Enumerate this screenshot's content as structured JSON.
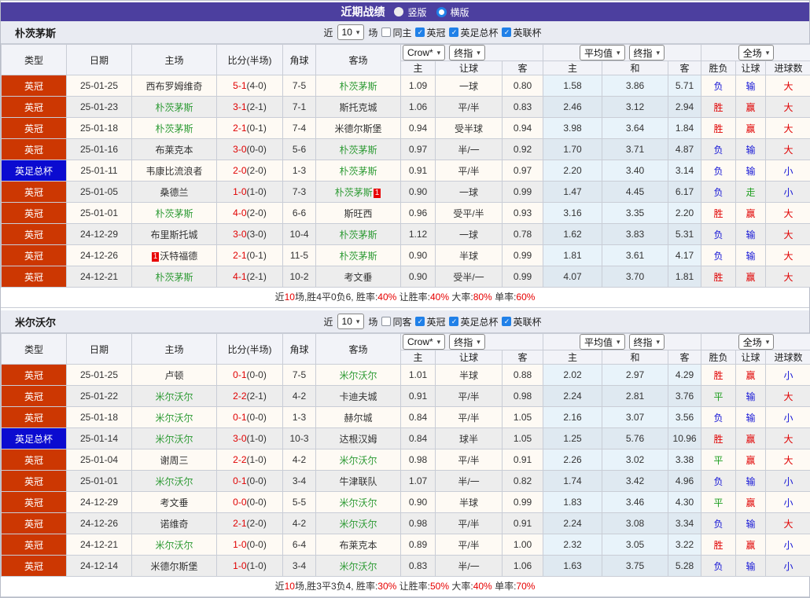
{
  "icons": {
    "check": "✓",
    "chevron_down": "▾"
  },
  "topbar": {
    "title": "近期战绩",
    "vertical": "竖版",
    "horizontal": "横版"
  },
  "labels": {
    "near": "近",
    "games": "场"
  },
  "controls": {
    "count": "10",
    "bookmaker": "Crow*",
    "stage": "终指",
    "average": "平均值",
    "stage2": "终指",
    "scope": "全场"
  },
  "filters": {
    "leagues": [
      "英冠",
      "英足总杯",
      "英联杯"
    ]
  },
  "columns": {
    "type": "类型",
    "date": "日期",
    "home": "主场",
    "score": "比分(半场)",
    "corner": "角球",
    "away": "客场"
  },
  "sub_columns": {
    "asian_home": "主",
    "asian_handicap": "让球",
    "asian_away": "客",
    "euro_home": "主",
    "euro_draw": "和",
    "euro_away": "客",
    "result_wdl": "胜负",
    "result_handicap": "让球",
    "result_goals": "进球数"
  },
  "colors": {
    "purple": "#4c3f9f",
    "league_orange": "#cc3702",
    "cup_blue": "#0b0bd0",
    "self_green": "#2e9b35",
    "win_red": "#e00000",
    "lose_blue": "#1616d6",
    "draw_green": "#1f9e1f",
    "checkbox_blue": "#2080e8"
  },
  "sections": [
    {
      "team": "朴茨茅斯",
      "same_label": "同主",
      "rows": [
        {
          "lg": "英冠",
          "cup": false,
          "date": "25-01-25",
          "home": "西布罗姆维奇",
          "hg": false,
          "hb": "",
          "score": "5-1",
          "half": "(4-0)",
          "corner": "7-5",
          "away": "朴茨茅斯",
          "ag": true,
          "ab": "",
          "asian": [
            "1.09",
            "一球",
            "0.80"
          ],
          "euro": [
            "1.58",
            "3.86",
            "5.71"
          ],
          "res": [
            "负",
            "输",
            "大"
          ],
          "rc": [
            "b",
            "b",
            "r"
          ]
        },
        {
          "lg": "英冠",
          "cup": false,
          "date": "25-01-23",
          "home": "朴茨茅斯",
          "hg": true,
          "hb": "",
          "score": "3-1",
          "half": "(2-1)",
          "corner": "7-1",
          "away": "斯托克城",
          "ag": false,
          "ab": "",
          "asian": [
            "1.06",
            "平/半",
            "0.83"
          ],
          "euro": [
            "2.46",
            "3.12",
            "2.94"
          ],
          "res": [
            "胜",
            "赢",
            "大"
          ],
          "rc": [
            "r",
            "r",
            "r"
          ]
        },
        {
          "lg": "英冠",
          "cup": false,
          "date": "25-01-18",
          "home": "朴茨茅斯",
          "hg": true,
          "hb": "",
          "score": "2-1",
          "half": "(0-1)",
          "corner": "7-4",
          "away": "米德尔斯堡",
          "ag": false,
          "ab": "",
          "asian": [
            "0.94",
            "受半球",
            "0.94"
          ],
          "euro": [
            "3.98",
            "3.64",
            "1.84"
          ],
          "res": [
            "胜",
            "赢",
            "大"
          ],
          "rc": [
            "r",
            "r",
            "r"
          ]
        },
        {
          "lg": "英冠",
          "cup": false,
          "date": "25-01-16",
          "home": "布莱克本",
          "hg": false,
          "hb": "",
          "score": "3-0",
          "half": "(0-0)",
          "corner": "5-6",
          "away": "朴茨茅斯",
          "ag": true,
          "ab": "",
          "asian": [
            "0.97",
            "半/一",
            "0.92"
          ],
          "euro": [
            "1.70",
            "3.71",
            "4.87"
          ],
          "res": [
            "负",
            "输",
            "大"
          ],
          "rc": [
            "b",
            "b",
            "r"
          ]
        },
        {
          "lg": "英足总杯",
          "cup": true,
          "date": "25-01-11",
          "home": "韦康比流浪者",
          "hg": false,
          "hb": "",
          "score": "2-0",
          "half": "(2-0)",
          "corner": "1-3",
          "away": "朴茨茅斯",
          "ag": true,
          "ab": "",
          "asian": [
            "0.91",
            "平/半",
            "0.97"
          ],
          "euro": [
            "2.20",
            "3.40",
            "3.14"
          ],
          "res": [
            "负",
            "输",
            "小"
          ],
          "rc": [
            "b",
            "b",
            "b"
          ]
        },
        {
          "lg": "英冠",
          "cup": false,
          "date": "25-01-05",
          "home": "桑德兰",
          "hg": false,
          "hb": "",
          "score": "1-0",
          "half": "(1-0)",
          "corner": "7-3",
          "away": "朴茨茅斯",
          "ag": true,
          "ab": "1",
          "asian": [
            "0.90",
            "一球",
            "0.99"
          ],
          "euro": [
            "1.47",
            "4.45",
            "6.17"
          ],
          "res": [
            "负",
            "走",
            "小"
          ],
          "rc": [
            "b",
            "g",
            "b"
          ]
        },
        {
          "lg": "英冠",
          "cup": false,
          "date": "25-01-01",
          "home": "朴茨茅斯",
          "hg": true,
          "hb": "",
          "score": "4-0",
          "half": "(2-0)",
          "corner": "6-6",
          "away": "斯旺西",
          "ag": false,
          "ab": "",
          "asian": [
            "0.96",
            "受平/半",
            "0.93"
          ],
          "euro": [
            "3.16",
            "3.35",
            "2.20"
          ],
          "res": [
            "胜",
            "赢",
            "大"
          ],
          "rc": [
            "r",
            "r",
            "r"
          ]
        },
        {
          "lg": "英冠",
          "cup": false,
          "date": "24-12-29",
          "home": "布里斯托城",
          "hg": false,
          "hb": "",
          "score": "3-0",
          "half": "(3-0)",
          "corner": "10-4",
          "away": "朴茨茅斯",
          "ag": true,
          "ab": "",
          "asian": [
            "1.12",
            "一球",
            "0.78"
          ],
          "euro": [
            "1.62",
            "3.83",
            "5.31"
          ],
          "res": [
            "负",
            "输",
            "大"
          ],
          "rc": [
            "b",
            "b",
            "r"
          ]
        },
        {
          "lg": "英冠",
          "cup": false,
          "date": "24-12-26",
          "home": "沃特福德",
          "hg": false,
          "hb": "1",
          "score": "2-1",
          "half": "(0-1)",
          "corner": "11-5",
          "away": "朴茨茅斯",
          "ag": true,
          "ab": "",
          "asian": [
            "0.90",
            "半球",
            "0.99"
          ],
          "euro": [
            "1.81",
            "3.61",
            "4.17"
          ],
          "res": [
            "负",
            "输",
            "大"
          ],
          "rc": [
            "b",
            "b",
            "r"
          ]
        },
        {
          "lg": "英冠",
          "cup": false,
          "date": "24-12-21",
          "home": "朴茨茅斯",
          "hg": true,
          "hb": "",
          "score": "4-1",
          "half": "(2-1)",
          "corner": "10-2",
          "away": "考文垂",
          "ag": false,
          "ab": "",
          "asian": [
            "0.90",
            "受半/一",
            "0.99"
          ],
          "euro": [
            "4.07",
            "3.70",
            "1.81"
          ],
          "res": [
            "胜",
            "赢",
            "大"
          ],
          "rc": [
            "r",
            "r",
            "r"
          ]
        }
      ],
      "summary": {
        "t1": "近",
        "games": "10",
        "record": "场,胜4平0负6, 胜率:",
        "win": "40%",
        "t2": " 让胜率:",
        "hcp": "40%",
        "t3": " 大率:",
        "big": "80%",
        "t4": " 单率:",
        "single": "60%"
      }
    },
    {
      "team": "米尔沃尔",
      "same_label": "同客",
      "rows": [
        {
          "lg": "英冠",
          "cup": false,
          "date": "25-01-25",
          "home": "卢顿",
          "hg": false,
          "hb": "",
          "score": "0-1",
          "half": "(0-0)",
          "corner": "7-5",
          "away": "米尔沃尔",
          "ag": true,
          "ab": "",
          "asian": [
            "1.01",
            "半球",
            "0.88"
          ],
          "euro": [
            "2.02",
            "2.97",
            "4.29"
          ],
          "res": [
            "胜",
            "赢",
            "小"
          ],
          "rc": [
            "r",
            "r",
            "b"
          ]
        },
        {
          "lg": "英冠",
          "cup": false,
          "date": "25-01-22",
          "home": "米尔沃尔",
          "hg": true,
          "hb": "",
          "score": "2-2",
          "half": "(2-1)",
          "corner": "4-2",
          "away": "卡迪夫城",
          "ag": false,
          "ab": "",
          "asian": [
            "0.91",
            "平/半",
            "0.98"
          ],
          "euro": [
            "2.24",
            "2.81",
            "3.76"
          ],
          "res": [
            "平",
            "输",
            "大"
          ],
          "rc": [
            "g",
            "b",
            "r"
          ]
        },
        {
          "lg": "英冠",
          "cup": false,
          "date": "25-01-18",
          "home": "米尔沃尔",
          "hg": true,
          "hb": "",
          "score": "0-1",
          "half": "(0-0)",
          "corner": "1-3",
          "away": "赫尔城",
          "ag": false,
          "ab": "",
          "asian": [
            "0.84",
            "平/半",
            "1.05"
          ],
          "euro": [
            "2.16",
            "3.07",
            "3.56"
          ],
          "res": [
            "负",
            "输",
            "小"
          ],
          "rc": [
            "b",
            "b",
            "b"
          ]
        },
        {
          "lg": "英足总杯",
          "cup": true,
          "date": "25-01-14",
          "home": "米尔沃尔",
          "hg": true,
          "hb": "",
          "score": "3-0",
          "half": "(1-0)",
          "corner": "10-3",
          "away": "达根汉姆",
          "ag": false,
          "ab": "",
          "asian": [
            "0.84",
            "球半",
            "1.05"
          ],
          "euro": [
            "1.25",
            "5.76",
            "10.96"
          ],
          "res": [
            "胜",
            "赢",
            "大"
          ],
          "rc": [
            "r",
            "r",
            "r"
          ]
        },
        {
          "lg": "英冠",
          "cup": false,
          "date": "25-01-04",
          "home": "谢周三",
          "hg": false,
          "hb": "",
          "score": "2-2",
          "half": "(1-0)",
          "corner": "4-2",
          "away": "米尔沃尔",
          "ag": true,
          "ab": "",
          "asian": [
            "0.98",
            "平/半",
            "0.91"
          ],
          "euro": [
            "2.26",
            "3.02",
            "3.38"
          ],
          "res": [
            "平",
            "赢",
            "大"
          ],
          "rc": [
            "g",
            "r",
            "r"
          ]
        },
        {
          "lg": "英冠",
          "cup": false,
          "date": "25-01-01",
          "home": "米尔沃尔",
          "hg": true,
          "hb": "",
          "score": "0-1",
          "half": "(0-0)",
          "corner": "3-4",
          "away": "牛津联队",
          "ag": false,
          "ab": "",
          "asian": [
            "1.07",
            "半/一",
            "0.82"
          ],
          "euro": [
            "1.74",
            "3.42",
            "4.96"
          ],
          "res": [
            "负",
            "输",
            "小"
          ],
          "rc": [
            "b",
            "b",
            "b"
          ]
        },
        {
          "lg": "英冠",
          "cup": false,
          "date": "24-12-29",
          "home": "考文垂",
          "hg": false,
          "hb": "",
          "score": "0-0",
          "half": "(0-0)",
          "corner": "5-5",
          "away": "米尔沃尔",
          "ag": true,
          "ab": "",
          "asian": [
            "0.90",
            "半球",
            "0.99"
          ],
          "euro": [
            "1.83",
            "3.46",
            "4.30"
          ],
          "res": [
            "平",
            "赢",
            "小"
          ],
          "rc": [
            "g",
            "r",
            "b"
          ]
        },
        {
          "lg": "英冠",
          "cup": false,
          "date": "24-12-26",
          "home": "诺维奇",
          "hg": false,
          "hb": "",
          "score": "2-1",
          "half": "(2-0)",
          "corner": "4-2",
          "away": "米尔沃尔",
          "ag": true,
          "ab": "",
          "asian": [
            "0.98",
            "平/半",
            "0.91"
          ],
          "euro": [
            "2.24",
            "3.08",
            "3.34"
          ],
          "res": [
            "负",
            "输",
            "大"
          ],
          "rc": [
            "b",
            "b",
            "r"
          ]
        },
        {
          "lg": "英冠",
          "cup": false,
          "date": "24-12-21",
          "home": "米尔沃尔",
          "hg": true,
          "hb": "",
          "score": "1-0",
          "half": "(0-0)",
          "corner": "6-4",
          "away": "布莱克本",
          "ag": false,
          "ab": "",
          "asian": [
            "0.89",
            "平/半",
            "1.00"
          ],
          "euro": [
            "2.32",
            "3.05",
            "3.22"
          ],
          "res": [
            "胜",
            "赢",
            "小"
          ],
          "rc": [
            "r",
            "r",
            "b"
          ]
        },
        {
          "lg": "英冠",
          "cup": false,
          "date": "24-12-14",
          "home": "米德尔斯堡",
          "hg": false,
          "hb": "",
          "score": "1-0",
          "half": "(1-0)",
          "corner": "3-4",
          "away": "米尔沃尔",
          "ag": true,
          "ab": "",
          "asian": [
            "0.83",
            "半/一",
            "1.06"
          ],
          "euro": [
            "1.63",
            "3.75",
            "5.28"
          ],
          "res": [
            "负",
            "输",
            "小"
          ],
          "rc": [
            "b",
            "b",
            "b"
          ]
        }
      ],
      "summary": {
        "t1": "近",
        "games": "10",
        "record": "场,胜3平3负4, 胜率:",
        "win": "30%",
        "t2": " 让胜率:",
        "hcp": "50%",
        "t3": " 大率:",
        "big": "40%",
        "t4": " 单率:",
        "single": "70%"
      }
    }
  ]
}
